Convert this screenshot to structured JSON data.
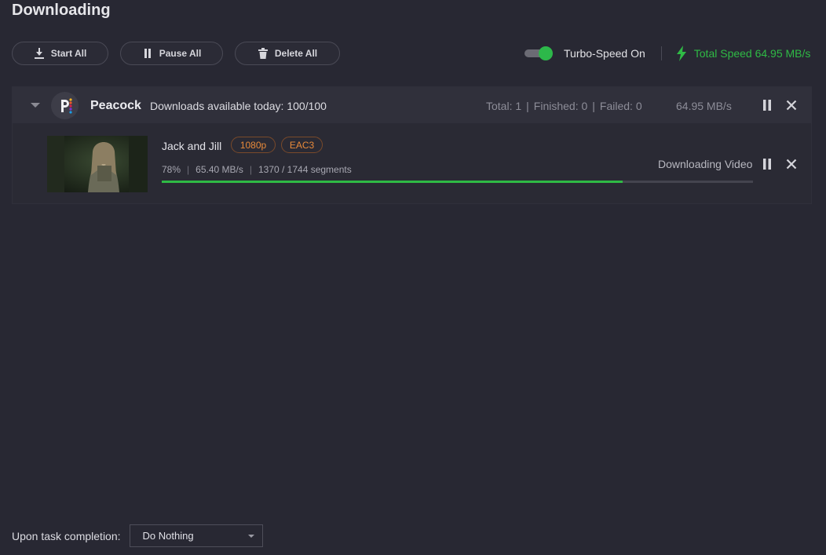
{
  "page": {
    "title": "Downloading"
  },
  "toolbar": {
    "start_all": "Start All",
    "pause_all": "Pause All",
    "delete_all": "Delete All"
  },
  "turbo": {
    "label": "Turbo-Speed On",
    "enabled": true,
    "total_speed": "Total Speed 64.95 MB/s"
  },
  "group": {
    "name": "Peacock",
    "quota": "Downloads available today: 100/100",
    "total": "Total: 1",
    "finished": "Finished: 0",
    "failed": "Failed: 0",
    "speed": "64.95 MB/s"
  },
  "item": {
    "title": "Jack and Jill",
    "resolution": "1080p",
    "audio": "EAC3",
    "percent": "78%",
    "speed": "65.40 MB/s",
    "segments": "1370 / 1744 segments",
    "status": "Downloading Video",
    "progress_fraction": 0.78
  },
  "footer": {
    "label": "Upon task completion:",
    "selected_option": "Do Nothing"
  },
  "colors": {
    "accent_green": "#2fba45",
    "tag_orange": "#e88a3a",
    "background": "#282833"
  }
}
